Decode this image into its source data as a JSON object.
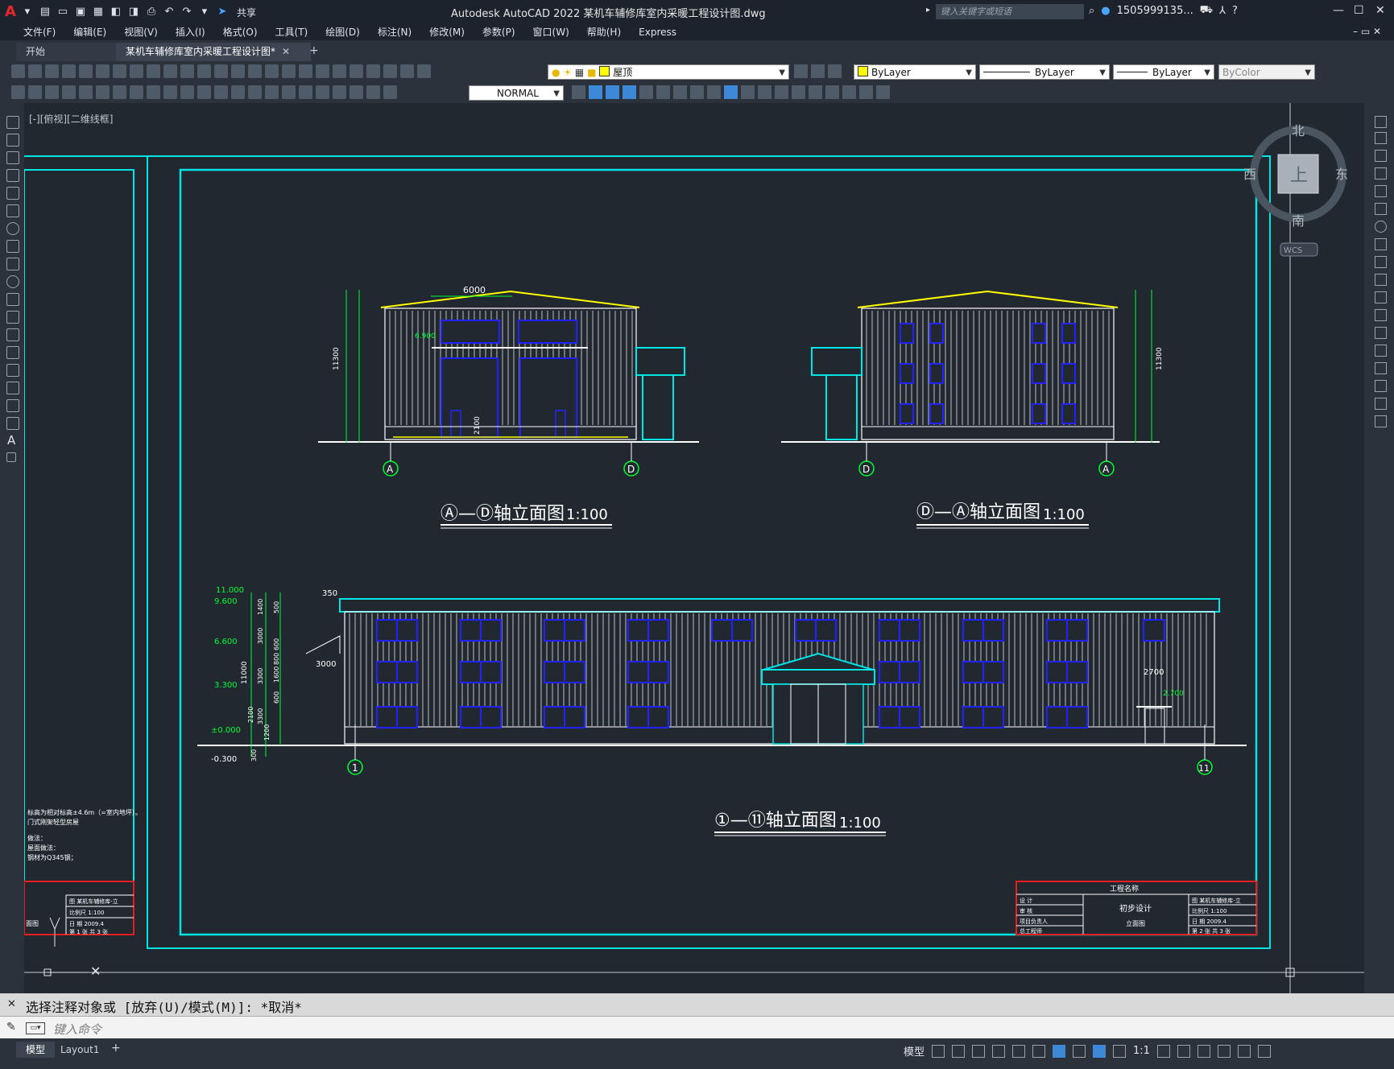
{
  "window": {
    "title": "Autodesk AutoCAD 2022    某机车辅修库室内采暖工程设计图.dwg",
    "share_label": "共享",
    "search_placeholder": "键入关键字或短语",
    "user": "1505999135..."
  },
  "menu": [
    "文件(F)",
    "编辑(E)",
    "视图(V)",
    "插入(I)",
    "格式(O)",
    "工具(T)",
    "绘图(D)",
    "标注(N)",
    "修改(M)",
    "参数(P)",
    "窗口(W)",
    "帮助(H)",
    "Express"
  ],
  "tabs": {
    "start": "开始",
    "active": "某机车辅修库室内采暖工程设计图*"
  },
  "toolbar": {
    "layer": "屋顶",
    "color": "ByLayer",
    "linetype": "ByLayer",
    "lineweight": "ByLayer",
    "plotstyle": "ByColor",
    "dimstyle": "NORMAL"
  },
  "viewport": {
    "label": "[-][俯视][二维线框]"
  },
  "viewcube": {
    "north": "北",
    "south": "南",
    "east": "东",
    "west": "西",
    "top": "上",
    "wcs": "WCS"
  },
  "drawing": {
    "elev1_title": "Ⓐ—Ⓓ轴立面图",
    "elev1_scale": "1:100",
    "elev2_title": "Ⓓ—Ⓐ轴立面图",
    "elev2_scale": "1:100",
    "elev3_title": "①—⑪轴立面图",
    "elev3_scale": "1:100",
    "axis_A": "A",
    "axis_D": "D",
    "axis_1": "1",
    "axis_11": "11",
    "dim_6000": "6000",
    "dim_6900": "6.900",
    "dim_2100": "2100",
    "dim_11300": "11300",
    "dim_350": "350",
    "dim_3000": "3000",
    "dim_2700": "2700",
    "dim_2700b": "2.700",
    "lv_11000": "11.000",
    "lv_9600": "9.600",
    "lv_6600": "6.600",
    "lv_3300": "3.300",
    "lv_000": "±0.000",
    "lv_m300": "-0.300",
    "v_dims": [
      "1400",
      "500",
      "3000",
      "600",
      "800",
      "1600",
      "3300",
      "3300",
      "600",
      "2100",
      "1200",
      "300"
    ],
    "v_11000": "11000",
    "notes": [
      "标高为相对标高±4.6m（=室内地坪）。",
      "门式刚架轻型房屋",
      "做法：",
      "屋面做法：",
      "钢材为Q345钢；"
    ],
    "titleblock_right": {
      "project": "工程名称",
      "design": "设  计",
      "check": "审  核",
      "pm": "项目负责人",
      "chief": "总工程师",
      "stage": "初步设计",
      "sheet": "立面图",
      "name": "图  某机车辅修库-立",
      "scale": "比例尺 1:100",
      "date": "日  期 2009.4",
      "pages": "第 2 张  共 3 张"
    },
    "titleblock_left": {
      "name": "图  某机车辅修库-立",
      "scale": "比例尺 1:100",
      "date": "日  期 2009.4",
      "pages": "第 1 张  共 3 张",
      "sheet": "面图"
    }
  },
  "command": {
    "history": "选择注释对象或 [放弃(U)/模式(M)]: *取消*",
    "placeholder": "键入命令"
  },
  "status": {
    "model": "模型",
    "layout": "Layout1",
    "model_btn": "模型",
    "scale": "1:1"
  }
}
